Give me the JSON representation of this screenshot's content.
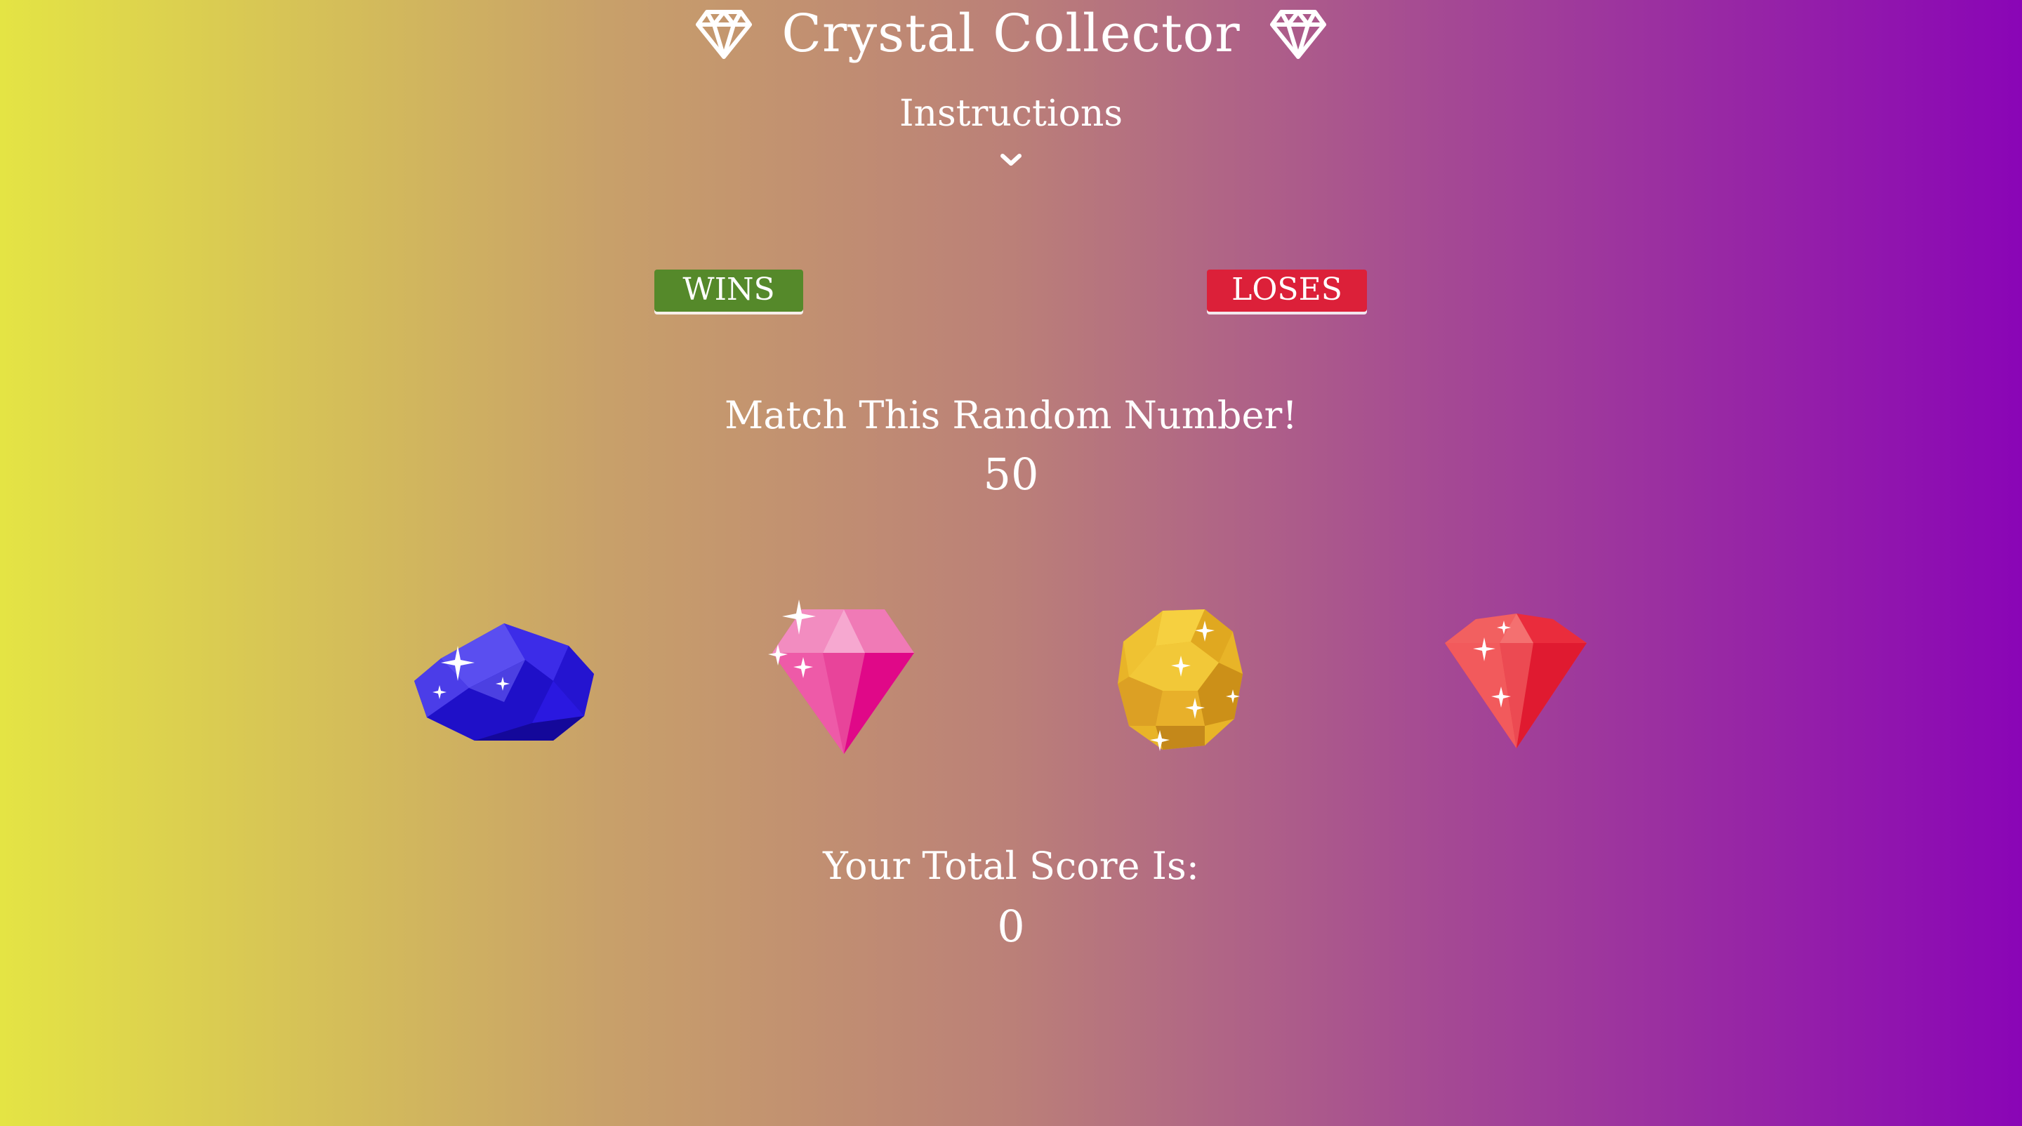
{
  "header": {
    "title": "Crystal Collector",
    "left_icon": "diamond-outline-icon",
    "right_icon": "diamond-outline-icon"
  },
  "instructions": {
    "label": "Instructions",
    "toggle_icon": "chevron-down-icon"
  },
  "record": {
    "wins_label": "WINS",
    "loses_label": "LOSES",
    "wins_color": "#55892a",
    "loses_color": "#dc2039"
  },
  "target": {
    "label": "Match This Random Number!",
    "value": "50"
  },
  "crystals": [
    {
      "name": "blue-crystal",
      "icon": "blue-gem-icon",
      "color": "#2a18e0"
    },
    {
      "name": "pink-crystal",
      "icon": "pink-gem-icon",
      "color": "#ec4aa0"
    },
    {
      "name": "yellow-crystal",
      "icon": "yellow-gem-icon",
      "color": "#e8b428"
    },
    {
      "name": "red-crystal",
      "icon": "red-gem-icon",
      "color": "#ee3a48"
    }
  ],
  "score": {
    "label": "Your Total Score Is:",
    "value": "0"
  },
  "theme": {
    "gradient_start": "#e4e444",
    "gradient_end": "#8a05b6",
    "text_color": "#ffffff"
  }
}
